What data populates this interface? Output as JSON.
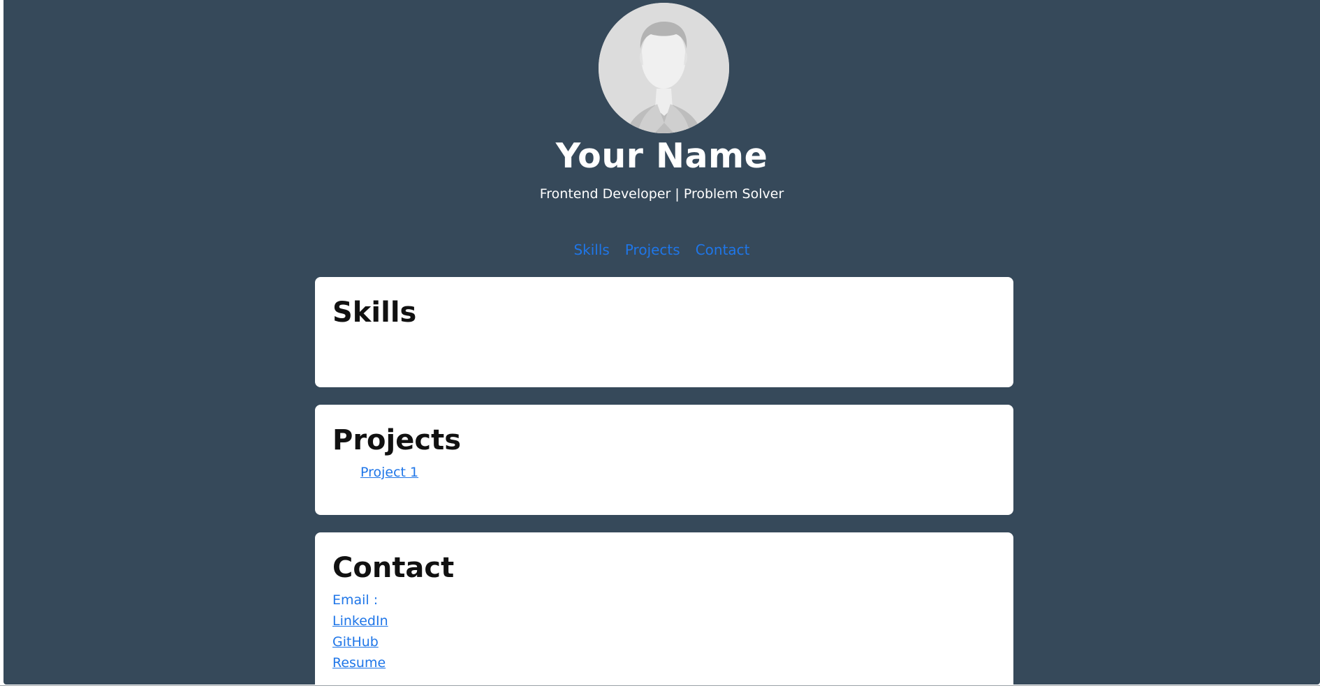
{
  "profile": {
    "name": "Your Name",
    "tagline": "Frontend Developer | Problem Solver",
    "avatar_icon": "person-silhouette-icon"
  },
  "nav": {
    "items": [
      {
        "label": "Skills"
      },
      {
        "label": "Projects"
      },
      {
        "label": "Contact"
      }
    ]
  },
  "sections": {
    "skills": {
      "title": "Skills"
    },
    "projects": {
      "title": "Projects",
      "items": [
        {
          "label": "Project 1"
        }
      ]
    },
    "contact": {
      "title": "Contact",
      "email_label": "Email :",
      "links": [
        {
          "label": "LinkedIn"
        },
        {
          "label": "GitHub"
        },
        {
          "label": "Resume"
        }
      ]
    }
  },
  "colors": {
    "background": "#36495a",
    "card": "#ffffff",
    "link": "#1f76e8",
    "heading": "#111111"
  }
}
